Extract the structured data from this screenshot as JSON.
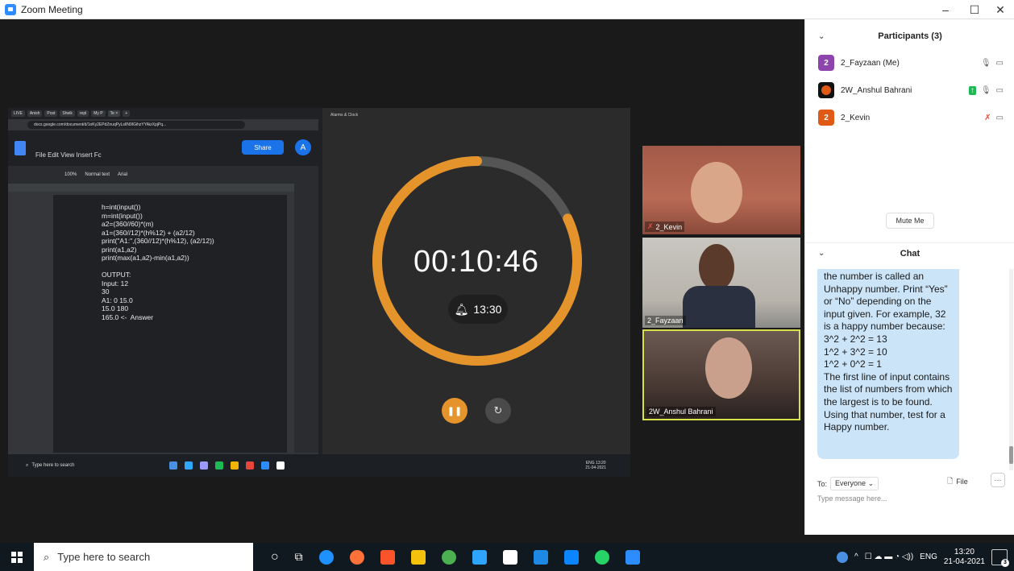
{
  "window": {
    "title": "Zoom Meeting",
    "min": "–",
    "max": "☐",
    "close": "✕"
  },
  "shared": {
    "chrome_tabs": [
      "LIVE",
      "Anish",
      "Post",
      "Sheik",
      "repl",
      "My P",
      "Te ×",
      "+"
    ],
    "url": "docs.google.com/document/d/1oKy2EPdZnuqPyLsIlN9IGihzYYAizXpjPq...",
    "doc_menu": "File  Edit  View  Insert  Fc",
    "share_label": "Share",
    "avatar_letter": "A",
    "doc_toolbar": [
      "100%",
      "Normal text",
      "Arial"
    ],
    "code_text": "h=int(input())\nm=int(input())\na2=(360//60)*(m)\na1=(360//12)*(h%12) + (a2/12)\nprint(\"A1:\",(360//12)*(h%12), (a2/12))\nprint(a1,a2)\nprint(max(a1,a2)-min(a1,a2))\n\nOUTPUT:\nInput: 12\n30\nA1: 0 15.0\n15.0 180\n165.0 <-  Answer",
    "clock_app_title": "Alarms & Clock",
    "timer": "00:10:46",
    "alarm_time": "13:30",
    "timer_progress": 0.82,
    "inner_search": "Type here to search",
    "inner_lang": "ENG",
    "inner_time": "13:20",
    "inner_date": "21-04-2021"
  },
  "videos": [
    {
      "name": "2_Kevin",
      "muted": true
    },
    {
      "name": "2_Fayzaan",
      "muted": false
    },
    {
      "name": "2W_Anshul Bahrani",
      "muted": false
    }
  ],
  "participants": {
    "header": "Participants (3)",
    "list": [
      {
        "avatar": "2",
        "name": "2_Fayzaan (Me)",
        "color": "#8e44ad"
      },
      {
        "avatar": "",
        "name": "2W_Anshul Bahrani",
        "color": "#111111"
      },
      {
        "avatar": "2",
        "name": "2_Kevin",
        "color": "#e05a16"
      }
    ],
    "mute_me": "Mute Me"
  },
  "chat": {
    "header": "Chat",
    "message": "the number is called an Unhappy number. Print “Yes” or “No” depending on the input given. For example, 32 is a happy number because:\n3^2 + 2^2 = 13\n1^2 + 3^2 = 10\n1^2 + 0^2 = 1\nThe first line of input contains the list of numbers from which the largest is to be found. Using that number, test for a Happy number.",
    "to_label": "To:",
    "to_value": "Everyone",
    "file_label": "File",
    "more": "···",
    "placeholder": "Type message here..."
  },
  "taskbar": {
    "search": "Type here to search",
    "lang": "ENG",
    "time": "13:20",
    "date": "21-04-2021",
    "notif_count": "3"
  }
}
